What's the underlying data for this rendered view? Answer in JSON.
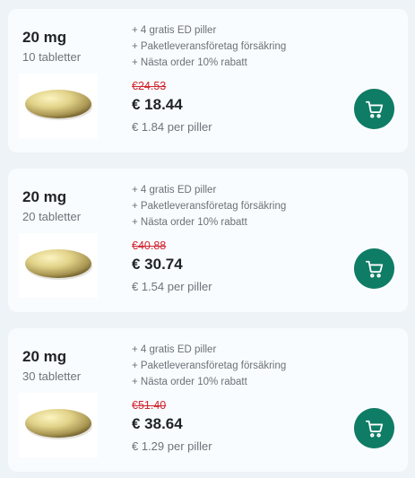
{
  "products": [
    {
      "dose": "20 mg",
      "count": "10 tabletter",
      "features": [
        "+ 4 gratis ED piller",
        "+ Paketleveransföretag försäkring",
        "+ Nästa order 10% rabatt"
      ],
      "old_price": "€24.53",
      "price": "€ 18.44",
      "per_pill": "€ 1.84 per piller",
      "image_icon": "pill-image",
      "cart_icon": "cart-icon"
    },
    {
      "dose": "20 mg",
      "count": "20 tabletter",
      "features": [
        "+ 4 gratis ED piller",
        "+ Paketleveransföretag försäkring",
        "+ Nästa order 10% rabatt"
      ],
      "old_price": "€40.88",
      "price": "€ 30.74",
      "per_pill": "€ 1.54 per piller",
      "image_icon": "pill-image",
      "cart_icon": "cart-icon"
    },
    {
      "dose": "20 mg",
      "count": "30 tabletter",
      "features": [
        "+ 4 gratis ED piller",
        "+ Paketleveransföretag försäkring",
        "+ Nästa order 10% rabatt"
      ],
      "old_price": "€51.40",
      "price": "€ 38.64",
      "per_pill": "€ 1.29 per piller",
      "image_icon": "pill-image",
      "cart_icon": "cart-icon"
    }
  ],
  "colors": {
    "card_bg": "#f9fcfe",
    "page_bg": "#eef3f8",
    "cart_button": "#0f7c66",
    "old_price": "#d1242f",
    "text_dark": "#1f2328",
    "text_muted": "#6d737a"
  }
}
